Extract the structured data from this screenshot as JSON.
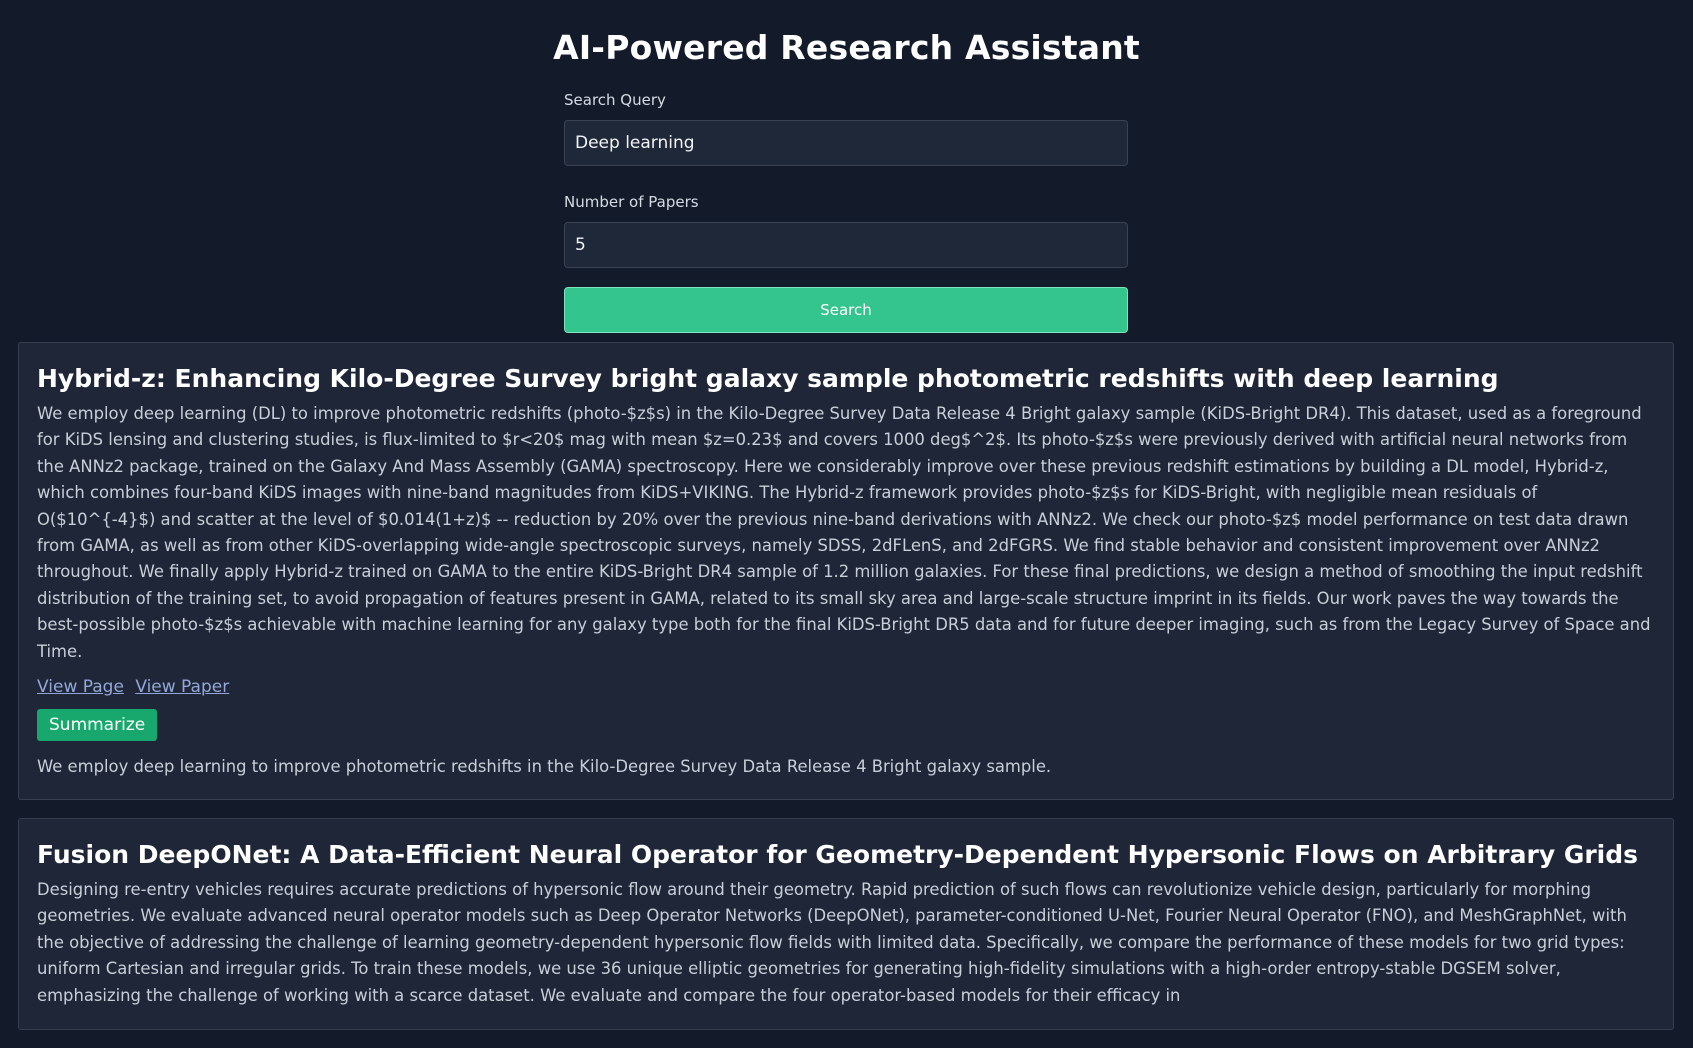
{
  "header": {
    "title": "AI-Powered Research Assistant"
  },
  "form": {
    "query_label": "Search Query",
    "query_value": "Deep learning",
    "count_label": "Number of Papers",
    "count_value": "5",
    "search_label": "Search"
  },
  "papers": [
    {
      "title": "Hybrid-z: Enhancing Kilo-Degree Survey bright galaxy sample photometric redshifts with deep learning",
      "abstract": "We employ deep learning (DL) to improve photometric redshifts (photo-$z$s) in the Kilo-Degree Survey Data Release 4 Bright galaxy sample (KiDS-Bright DR4). This dataset, used as a foreground for KiDS lensing and clustering studies, is flux-limited to $r<20$ mag with mean $z=0.23$ and covers 1000 deg$^2$. Its photo-$z$s were previously derived with artificial neural networks from the ANNz2 package, trained on the Galaxy And Mass Assembly (GAMA) spectroscopy. Here we considerably improve over these previous redshift estimations by building a DL model, Hybrid-z, which combines four-band KiDS images with nine-band magnitudes from KiDS+VIKING. The Hybrid-z framework provides photo-$z$s for KiDS-Bright, with negligible mean residuals of O($10^{-4}$) and scatter at the level of $0.014(1+z)$ -- reduction by 20% over the previous nine-band derivations with ANNz2. We check our photo-$z$ model performance on test data drawn from GAMA, as well as from other KiDS-overlapping wide-angle spectroscopic surveys, namely SDSS, 2dFLenS, and 2dFGRS. We find stable behavior and consistent improvement over ANNz2 throughout. We finally apply Hybrid-z trained on GAMA to the entire KiDS-Bright DR4 sample of 1.2 million galaxies. For these final predictions, we design a method of smoothing the input redshift distribution of the training set, to avoid propagation of features present in GAMA, related to its small sky area and large-scale structure imprint in its fields. Our work paves the way towards the best-possible photo-$z$s achievable with machine learning for any galaxy type both for the final KiDS-Bright DR5 data and for future deeper imaging, such as from the Legacy Survey of Space and Time.",
      "view_page_label": "View Page",
      "view_paper_label": "View Paper",
      "summarize_label": "Summarize",
      "summary": "We employ deep learning to improve photometric redshifts in the Kilo-Degree Survey Data Release 4 Bright galaxy sample."
    },
    {
      "title": "Fusion DeepONet: A Data-Efficient Neural Operator for Geometry-Dependent Hypersonic Flows on Arbitrary Grids",
      "abstract": "Designing re-entry vehicles requires accurate predictions of hypersonic flow around their geometry. Rapid prediction of such flows can revolutionize vehicle design, particularly for morphing geometries. We evaluate advanced neural operator models such as Deep Operator Networks (DeepONet), parameter-conditioned U-Net, Fourier Neural Operator (FNO), and MeshGraphNet, with the objective of addressing the challenge of learning geometry-dependent hypersonic flow fields with limited data. Specifically, we compare the performance of these models for two grid types: uniform Cartesian and irregular grids. To train these models, we use 36 unique elliptic geometries for generating high-fidelity simulations with a high-order entropy-stable DGSEM solver, emphasizing the challenge of working with a scarce dataset. We evaluate and compare the four operator-based models for their efficacy in"
    }
  ]
}
